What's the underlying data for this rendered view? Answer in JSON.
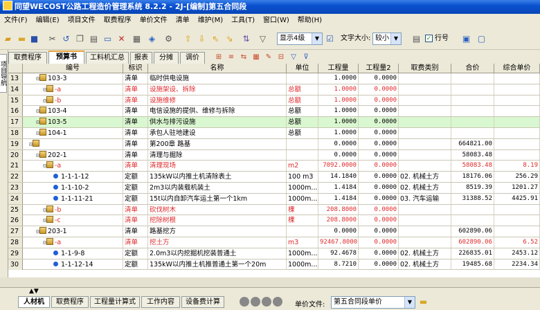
{
  "window": {
    "title": "同望WECOST公路工程造价管理系统  8.2.2  - 2J-[编制]第五合同段"
  },
  "menu": [
    "文件(F)",
    "编辑(E)",
    "项目文件",
    "取费程序",
    "单价文件",
    "清单",
    "维护(M)",
    "工具(T)",
    "窗口(W)",
    "帮助(H)"
  ],
  "toolbar": {
    "level_combo": "显示4级",
    "font_label": "文字大小:",
    "font_combo": "较小",
    "line_number_label": "行号"
  },
  "side_tab": "项目导航",
  "tabs": [
    "取费程序",
    "预算书",
    "工料机汇总",
    "报表",
    "分摊",
    "调价"
  ],
  "active_tab": 1,
  "columns": [
    "编号",
    "标识",
    "名称",
    "单位",
    "工程量",
    "工程量2",
    "取费类别",
    "合价",
    "综合单价"
  ],
  "rows": [
    {
      "no": "13",
      "code": "103-3",
      "id": "清单",
      "name": "临时供电设施",
      "unit": "",
      "qty": "1.0000",
      "qty2": "0.0000",
      "fee": "",
      "total": "",
      "unit_price": "",
      "red": false,
      "level": 2,
      "type": "folder"
    },
    {
      "no": "14",
      "code": "-a",
      "id": "清单",
      "name": "设施架设、拆除",
      "unit": "总额",
      "qty": "1.0000",
      "qty2": "0.0000",
      "fee": "",
      "total": "",
      "unit_price": "",
      "red": true,
      "level": 3,
      "type": "folder"
    },
    {
      "no": "15",
      "code": "-b",
      "id": "清单",
      "name": "设施维修",
      "unit": "总额",
      "qty": "1.0000",
      "qty2": "0.0000",
      "fee": "",
      "total": "",
      "unit_price": "",
      "red": true,
      "level": 3,
      "type": "folder"
    },
    {
      "no": "16",
      "code": "103-4",
      "id": "清单",
      "name": "电信设施的提供、维修与拆除",
      "unit": "总额",
      "qty": "1.0000",
      "qty2": "0.0000",
      "fee": "",
      "total": "",
      "unit_price": "",
      "red": false,
      "level": 2,
      "type": "folder"
    },
    {
      "no": "17",
      "code": "103-5",
      "id": "清单",
      "name": "供水与排污设施",
      "unit": "总额",
      "qty": "1.0000",
      "qty2": "0.0000",
      "fee": "",
      "total": "",
      "unit_price": "",
      "red": false,
      "level": 2,
      "type": "folder",
      "selected": true
    },
    {
      "no": "18",
      "code": "104-1",
      "id": "清单",
      "name": "承包人驻地建设",
      "unit": "总额",
      "qty": "1.0000",
      "qty2": "0.0000",
      "fee": "",
      "total": "",
      "unit_price": "",
      "red": false,
      "level": 2,
      "type": "folder"
    },
    {
      "no": "19",
      "code": "",
      "id": "清单",
      "name": "第200章  路基",
      "unit": "",
      "qty": "0.0000",
      "qty2": "0.0000",
      "fee": "",
      "total": "664821.00",
      "unit_price": "",
      "red": false,
      "level": 1,
      "type": "folder"
    },
    {
      "no": "20",
      "code": "202-1",
      "id": "清单",
      "name": "清理与掘除",
      "unit": "",
      "qty": "0.0000",
      "qty2": "0.0000",
      "fee": "",
      "total": "58083.48",
      "unit_price": "",
      "red": false,
      "level": 2,
      "type": "folder"
    },
    {
      "no": "21",
      "code": "-a",
      "id": "清单",
      "name": "清理现场",
      "unit": "m2",
      "qty": "7092.0000",
      "qty2": "0.0000",
      "fee": "",
      "total": "58083.48",
      "unit_price": "8.19",
      "red": true,
      "level": 3,
      "type": "folder"
    },
    {
      "no": "22",
      "code": "1-1-1-12",
      "id": "定额",
      "name": "135kW以内推土机清除表土",
      "unit": "100 m3",
      "qty": "14.1840",
      "qty2": "0.0000",
      "fee": "02. 机械土方",
      "total": "18176.06",
      "unit_price": "256.29",
      "red": false,
      "level": 4,
      "type": "dot"
    },
    {
      "no": "23",
      "code": "1-1-10-2",
      "id": "定额",
      "name": "2m3以内装载机装土",
      "unit": "1000m...",
      "qty": "1.4184",
      "qty2": "0.0000",
      "fee": "02. 机械土方",
      "total": "8519.39",
      "unit_price": "1201.27",
      "red": false,
      "level": 4,
      "type": "dot"
    },
    {
      "no": "24",
      "code": "1-1-11-21",
      "id": "定额",
      "name": "15t以内自卸汽车运土第一个1km",
      "unit": "1000m...",
      "qty": "1.4184",
      "qty2": "0.0000",
      "fee": "03. 汽车运输",
      "total": "31388.52",
      "unit_price": "4425.91",
      "red": false,
      "level": 4,
      "type": "dot"
    },
    {
      "no": "25",
      "code": "-b",
      "id": "清单",
      "name": "砍伐树木",
      "unit": "棵",
      "qty": "208.8000",
      "qty2": "0.0000",
      "fee": "",
      "total": "",
      "unit_price": "",
      "red": true,
      "level": 3,
      "type": "folder"
    },
    {
      "no": "26",
      "code": "-c",
      "id": "清单",
      "name": "挖除树根",
      "unit": "棵",
      "qty": "208.8000",
      "qty2": "0.0000",
      "fee": "",
      "total": "",
      "unit_price": "",
      "red": true,
      "level": 3,
      "type": "folder"
    },
    {
      "no": "27",
      "code": "203-1",
      "id": "清单",
      "name": "路基挖方",
      "unit": "",
      "qty": "0.0000",
      "qty2": "0.0000",
      "fee": "",
      "total": "602890.06",
      "unit_price": "",
      "red": false,
      "level": 2,
      "type": "folder"
    },
    {
      "no": "28",
      "code": "-a",
      "id": "清单",
      "name": "挖土方",
      "unit": "m3",
      "qty": "92467.8000",
      "qty2": "0.0000",
      "fee": "",
      "total": "602890.06",
      "unit_price": "6.52",
      "red": true,
      "level": 3,
      "type": "folder"
    },
    {
      "no": "29",
      "code": "1-1-9-8",
      "id": "定额",
      "name": "2.0m3以内挖掘机挖装普通土",
      "unit": "1000m...",
      "qty": "92.4678",
      "qty2": "0.0000",
      "fee": "02. 机械土方",
      "total": "226835.01",
      "unit_price": "2453.12",
      "red": false,
      "level": 4,
      "type": "dot"
    },
    {
      "no": "30",
      "code": "1-1-12-14",
      "id": "定额",
      "name": "135kW以内推土机推普通土第一个20m",
      "unit": "1000m...",
      "qty": "8.7210",
      "qty2": "0.0000",
      "fee": "02. 机械土方",
      "total": "19485.68",
      "unit_price": "2234.34",
      "red": false,
      "level": 4,
      "type": "dot"
    }
  ],
  "bottom_tabs": [
    "人材机",
    "取费程序",
    "工程量计算式",
    "工作内容",
    "设备费计算"
  ],
  "price_file": {
    "label": "单价文件:",
    "value": "第五合同段单价"
  }
}
